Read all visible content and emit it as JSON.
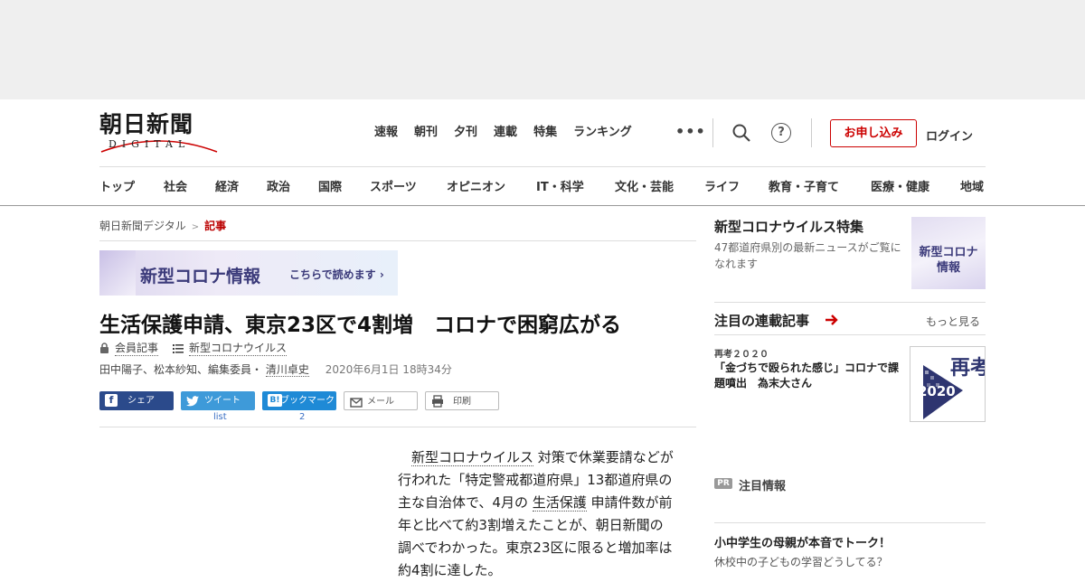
{
  "header": {
    "logo_kanji": "朝日新聞",
    "logo_sub": "DIGITAL",
    "top_nav": [
      "速報",
      "朝刊",
      "夕刊",
      "連載",
      "特集",
      "ランキング"
    ],
    "more_dots": "•••",
    "help_glyph": "?",
    "apply_label": "お申し込み",
    "login_label": "ログイン"
  },
  "categories": [
    "トップ",
    "社会",
    "経済",
    "政治",
    "国際",
    "スポーツ",
    "オピニオン",
    "IT・科学",
    "文化・芸能",
    "ライフ",
    "教育・子育て",
    "医療・健康",
    "地域"
  ],
  "breadcrumb": {
    "home": "朝日新聞デジタル",
    "sep": ">",
    "current": "記事"
  },
  "banner": {
    "title": "新型コロナ情報",
    "cta": "こちらで読めます ›"
  },
  "article": {
    "headline": "生活保護申請、東京23区で4割増　コロナで困窮広がる",
    "member_label": "会員記事",
    "topic_label": "新型コロナウイルス",
    "authors_prefix": "田中陽子、松本紗知、編集委員・",
    "author_link": "清川卓史",
    "date": "2020年6月1日 18時34分",
    "body": [
      {
        "t": "　",
        "kw": false
      },
      {
        "t": "新型コロナウイルス",
        "kw": true
      },
      {
        "t": " 対策で休業要請などが行われた「特定警戒都道府県」13都道府県の主な自治体で、4月の ",
        "kw": false
      },
      {
        "t": "生活保護",
        "kw": true
      },
      {
        "t": " 申請件数が前年と比べて約3割増えたことが、朝日新聞の調べでわかった。東京23区に限ると増加率は約4割に達した。",
        "kw": false
      }
    ]
  },
  "share": {
    "facebook": "シェア",
    "twitter": "ツイート",
    "twitter_count": "list",
    "hatena": "ブックマーク",
    "hatena_icon": "B!",
    "hatena_count": "2",
    "mail": "メール",
    "print": "印刷"
  },
  "sidebar": {
    "feature_title": "新型コロナウイルス特集",
    "feature_desc": "47都道府県別の最新ニュースがご覧になれます",
    "feature_thumb_line1": "新型コロナ",
    "feature_thumb_line2": "情報",
    "series_heading": "注目の連載記事",
    "more_label": "もっと見る",
    "series_tag": "再考２０２０",
    "series_title": "「金づちで殴られた感じ」コロナで課題噴出　為末大さん",
    "series_thumb_big": "再考",
    "series_thumb_year": "2020",
    "pr_badge": "PR",
    "pr_label": "注目情報",
    "pr_title": "小中学生の母親が本音でトーク！",
    "pr_sub": "休校中の子どもの学習どうしてる？"
  },
  "colors": {
    "accent_red": "#cc0000",
    "facebook": "#2b4a8b",
    "twitter": "#3e9ad9",
    "hatena": "#1f8ad6",
    "banner_purple": "#3b3a7a"
  }
}
